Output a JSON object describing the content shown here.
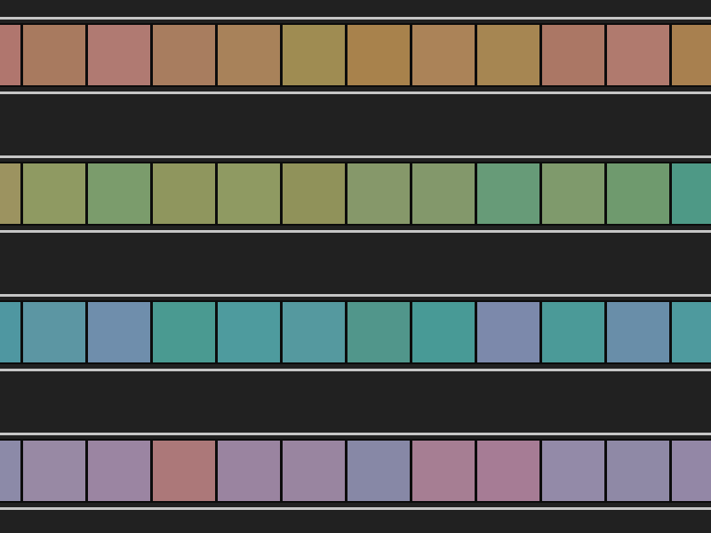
{
  "rows": [
    {
      "name": "row-1",
      "tiles": [
        "#b0766e",
        "#a87a5f",
        "#b07a72",
        "#a87d5f",
        "#a8825a",
        "#9f8c52",
        "#a8824c",
        "#ab8358",
        "#a68652",
        "#ab7765",
        "#b07a6e",
        "#a8804f"
      ]
    },
    {
      "name": "row-2",
      "tiles": [
        "#9c9360",
        "#8f9a62",
        "#7b9c6c",
        "#8f965e",
        "#8f9a62",
        "#90925a",
        "#86986a",
        "#83986b",
        "#679b78",
        "#7f9a6c",
        "#6f9a6e",
        "#4e9986"
      ]
    },
    {
      "name": "row-3",
      "tiles": [
        "#4f97a1",
        "#5c96a3",
        "#6f8eac",
        "#4a9a91",
        "#4e9b9e",
        "#55999f",
        "#51968b",
        "#489a96",
        "#7c89ab",
        "#4b9a98",
        "#698ea9",
        "#4e9a9e"
      ]
    },
    {
      "name": "row-4",
      "tiles": [
        "#8c8aa8",
        "#9889a4",
        "#9b85a2",
        "#ac7879",
        "#9a84a0",
        "#9985a0",
        "#8788a6",
        "#a67e93",
        "#a67c95",
        "#938aa8",
        "#8f89a6",
        "#9387a6"
      ]
    }
  ]
}
